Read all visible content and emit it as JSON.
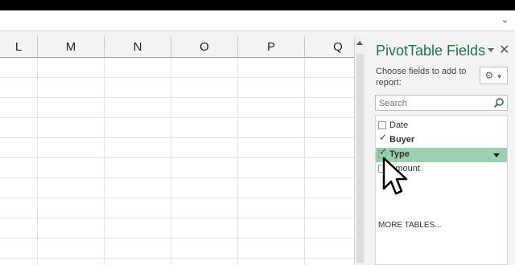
{
  "columns": [
    "L",
    "M",
    "N",
    "O",
    "P",
    "Q"
  ],
  "pane": {
    "title": "PivotTable Fields",
    "subtitle": "Choose fields to add to report:",
    "gear_icon": "gear-icon",
    "search_placeholder": "Search",
    "fields": [
      {
        "label": "Date",
        "checked": false,
        "bold": false,
        "selected": false
      },
      {
        "label": "Buyer",
        "checked": true,
        "bold": true,
        "selected": false
      },
      {
        "label": "Type",
        "checked": true,
        "bold": true,
        "selected": true
      },
      {
        "label": "Amount",
        "checked": false,
        "bold": false,
        "selected": false
      }
    ],
    "more_tables": "MORE TABLES..."
  },
  "colors": {
    "accent": "#217346",
    "selected_row": "#9bcfae"
  }
}
